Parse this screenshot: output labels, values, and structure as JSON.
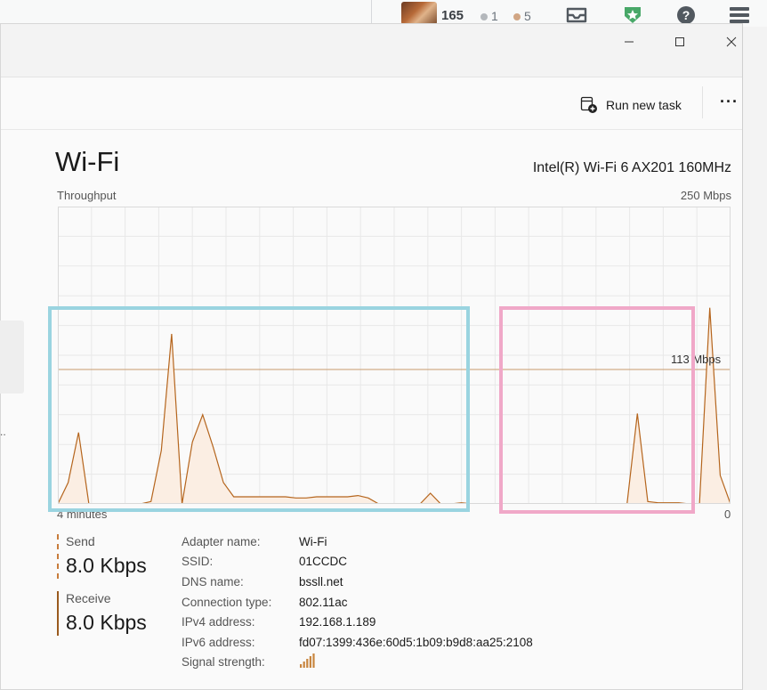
{
  "topbar": {
    "reputation": "165",
    "silver_badges": "1",
    "bronze_badges": "5",
    "icons": [
      "avatar",
      "inbox-icon",
      "achievements-icon",
      "help-icon",
      "site-switcher-icon"
    ]
  },
  "window": {
    "controls": [
      "minimize-icon",
      "maximize-icon",
      "close-icon"
    ]
  },
  "commandbar": {
    "run_task_label": "Run new task",
    "more_label": "···"
  },
  "performance": {
    "title": "Wi-Fi",
    "adapter_model": "Intel(R) Wi-Fi 6 AX201 160MHz",
    "chart_label_left": "Throughput",
    "chart_label_right": "250 Mbps",
    "marker_label": "113 Mbps",
    "time_label": "4 minutes",
    "zero_label": "0"
  },
  "chart_data": {
    "type": "area",
    "title": "Throughput",
    "ylim": [
      0,
      250
    ],
    "y_unit": "Mbps",
    "x_span": "4 minutes",
    "reference_line": 113,
    "grid": true,
    "series": [
      {
        "values": [
          0,
          18,
          60,
          0,
          0,
          0,
          0,
          0,
          0,
          2,
          45,
          143,
          0,
          52,
          75,
          48,
          18,
          6,
          6,
          6,
          6,
          6,
          6,
          5,
          5,
          6,
          6,
          6,
          6,
          7,
          5,
          0,
          0,
          0,
          0,
          0,
          9,
          0,
          0,
          1,
          0,
          0,
          0,
          0,
          0,
          0,
          0,
          0,
          0,
          0,
          0,
          0,
          0,
          0,
          0,
          76,
          2,
          1,
          1,
          1,
          0,
          0,
          0,
          0,
          0,
          0,
          0,
          0,
          0,
          0,
          0,
          0,
          0,
          0,
          0,
          0
        ]
      }
    ],
    "series_plotted_ranges": {
      "first_segment_points": 41,
      "gap_points": 14,
      "second_segment": [
        0,
        76,
        2,
        1,
        1,
        1,
        0,
        0,
        165,
        24,
        0
      ]
    }
  },
  "stats": {
    "send_label": "Send",
    "send_value": "8.0 Kbps",
    "send_color": "#c87c3c",
    "receive_label": "Receive",
    "receive_value": "8.0 Kbps",
    "receive_color": "#9a5a1e"
  },
  "properties": [
    {
      "key": "Adapter name:",
      "value": "Wi-Fi"
    },
    {
      "key": "SSID:",
      "value": "01CCDC"
    },
    {
      "key": "DNS name:",
      "value": "bssll.net"
    },
    {
      "key": "Connection type:",
      "value": "802.11ac"
    },
    {
      "key": "IPv4 address:",
      "value": "192.168.1.189"
    },
    {
      "key": "IPv6 address:",
      "value": "fd07:1399:436e:60d5:1b09:b9d8:aa25:2108"
    },
    {
      "key": "Signal strength:",
      "value": ""
    }
  ],
  "colors": {
    "chart_line": "#b5651d",
    "chart_fill": "#fbeee3",
    "grid": "#e8e8e8",
    "reference_line": "#c89a6c",
    "highlight_blue": "#9ad4e0",
    "highlight_pink": "#f0a8c8"
  }
}
